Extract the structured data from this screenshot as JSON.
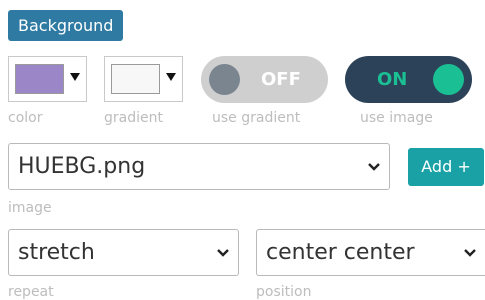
{
  "section": {
    "label": "Background"
  },
  "color_picker": {
    "caption": "color",
    "value": "#9b87c8"
  },
  "gradient_picker": {
    "caption": "gradient",
    "value": "#f7f7f7"
  },
  "use_gradient": {
    "caption": "use gradient",
    "state": "OFF"
  },
  "use_image": {
    "caption": "use image",
    "state": "ON"
  },
  "image": {
    "value": "HUEBG.png",
    "caption": "image",
    "add_label": "Add +"
  },
  "repeat": {
    "value": "stretch",
    "caption": "repeat"
  },
  "position": {
    "value": "center center",
    "caption": "position"
  },
  "colors": {
    "primary": "#2e7aa3",
    "teal": "#19a1a6",
    "toggle_off": "#cfcfcf",
    "toggle_on": "#2b4258",
    "toggle_on_knob": "#1bbf94"
  }
}
